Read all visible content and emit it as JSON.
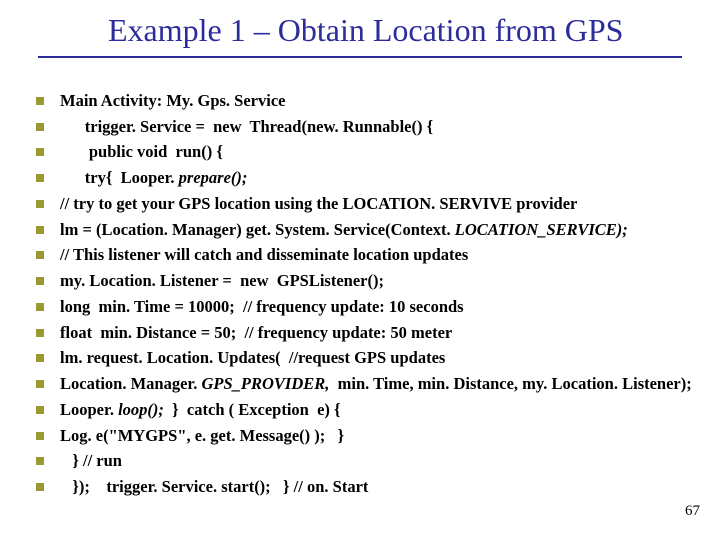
{
  "title": "Example 1 – Obtain Location from GPS",
  "page_number": "67",
  "lines": [
    {
      "spans": [
        {
          "t": "Main Activity: My. Gps. Service",
          "b": true
        }
      ]
    },
    {
      "spans": [
        {
          "t": "      trigger. Service =  ",
          "b": true
        },
        {
          "t": "new  ",
          "b": true
        },
        {
          "t": "Thread(",
          "b": true
        },
        {
          "t": "new",
          "b": true
        },
        {
          "t": ". Runnable() {",
          "b": true
        }
      ]
    },
    {
      "spans": [
        {
          "t": "       ",
          "b": true
        },
        {
          "t": "public void  ",
          "b": true
        },
        {
          "t": "run() {",
          "b": true
        }
      ]
    },
    {
      "spans": [
        {
          "t": "      ",
          "b": true
        },
        {
          "t": "try",
          "b": true
        },
        {
          "t": "{  Looper. ",
          "b": true
        },
        {
          "t": "prepare();",
          "b": true,
          "i": true
        }
      ]
    },
    {
      "spans": [
        {
          "t": "// try to get your GPS location using the LOCATION. SERVIVE provider",
          "b": true
        }
      ]
    },
    {
      "spans": [
        {
          "t": "lm = (Location. Manager) get. System. Service(Context. ",
          "b": true
        },
        {
          "t": "LOCATION_SERVICE);",
          "b": true,
          "i": true
        }
      ]
    },
    {
      "spans": [
        {
          "t": "// This listener will catch and disseminate location updates",
          "b": true
        }
      ]
    },
    {
      "spans": [
        {
          "t": "my. Location. Listener =  ",
          "b": true
        },
        {
          "t": "new  ",
          "b": true
        },
        {
          "t": "GPSListener();",
          "b": true
        }
      ]
    },
    {
      "spans": [
        {
          "t": "long  ",
          "b": true
        },
        {
          "t": "min. Time = 10000;  // frequency update: 10 seconds",
          "b": true
        }
      ]
    },
    {
      "spans": [
        {
          "t": "float  ",
          "b": true
        },
        {
          "t": "min. Distance = 50;  // frequency update: 50 meter",
          "b": true
        }
      ]
    },
    {
      "spans": [
        {
          "t": "lm. request. Location. Updates(  //request GPS updates",
          "b": true
        }
      ]
    },
    {
      "spans": [
        {
          "t": "Location. Manager. ",
          "b": true
        },
        {
          "t": "GPS_PROVIDER,  ",
          "b": true,
          "i": true
        },
        {
          "t": "min. Time, min. Distance, my. Location. Listener);",
          "b": true
        }
      ]
    },
    {
      "spans": [
        {
          "t": "Looper. ",
          "b": true
        },
        {
          "t": "loop();",
          "b": true,
          "i": true
        },
        {
          "t": "  }  ",
          "b": true
        },
        {
          "t": "catch ",
          "b": true
        },
        {
          "t": "( Exception  e) {",
          "b": true
        }
      ]
    },
    {
      "spans": [
        {
          "t": "Log. e(\"MYGPS\", e. get. Message() );   }",
          "b": true
        }
      ]
    },
    {
      "spans": [
        {
          "t": "   } // run",
          "b": true
        }
      ]
    },
    {
      "spans": [
        {
          "t": "   });    trigger. Service. start();   } // on. Start",
          "b": true
        }
      ]
    }
  ]
}
